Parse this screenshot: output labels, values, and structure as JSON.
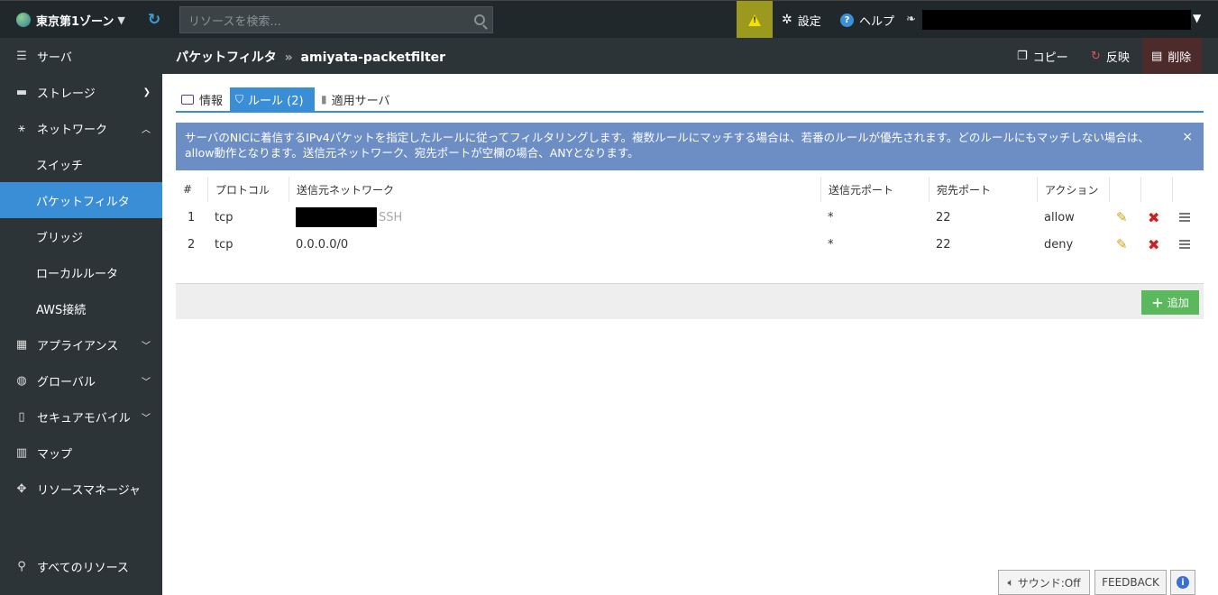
{
  "topbar": {
    "zone": "東京第1ゾーン",
    "zone_caret": "▼",
    "search_placeholder": "リソースを検索...",
    "settings": "設定",
    "help": "ヘルプ",
    "user_caret": "▼"
  },
  "sidebar": {
    "items": [
      {
        "label": "サーバ",
        "icon": "server-icon"
      },
      {
        "label": "ストレージ",
        "icon": "storage-icon"
      },
      {
        "label": "ネットワーク",
        "icon": "network-icon"
      },
      {
        "label": "アプライアンス",
        "icon": "appliance-icon"
      },
      {
        "label": "グローバル",
        "icon": "globe-icon"
      },
      {
        "label": "セキュアモバイル",
        "icon": "mobile-icon"
      },
      {
        "label": "マップ",
        "icon": "map-icon"
      },
      {
        "label": "リソースマネージャ",
        "icon": "puzzle-icon"
      }
    ],
    "network_sub": [
      "スイッチ",
      "パケットフィルタ",
      "ブリッジ",
      "ローカルルータ",
      "AWS接続"
    ],
    "all_resources": "すべてのリソース"
  },
  "header": {
    "breadcrumb_parent": "パケットフィルタ",
    "breadcrumb_sep": "»",
    "breadcrumb_current": "amiyata-packetfilter",
    "copy": "コピー",
    "apply": "反映",
    "delete": "削除"
  },
  "tabs": [
    "情報",
    "ルール (2)",
    "適用サーバ"
  ],
  "notice": "サーバのNICに着信するIPv4パケットを指定したルールに従ってフィルタリングします。複数ルールにマッチする場合は、若番のルールが優先されます。どのルールにもマッチしない場合は、allow動作となります。送信元ネットワーク、宛先ポートが空欄の場合、ANYとなります。",
  "table": {
    "headers": [
      "#",
      "プロトコル",
      "送信元ネットワーク",
      "送信元ポート",
      "宛先ポート",
      "アクション"
    ],
    "rows": [
      {
        "num": "1",
        "protocol": "tcp",
        "source_network": "",
        "source_note": "SSH",
        "source_port": "*",
        "dest_port": "22",
        "action": "allow"
      },
      {
        "num": "2",
        "protocol": "tcp",
        "source_network": "0.0.0.0/0",
        "source_note": "",
        "source_port": "*",
        "dest_port": "22",
        "action": "deny"
      }
    ]
  },
  "add_button": "追加",
  "footer": {
    "sound": "サウンド:Off",
    "feedback": "FEEDBACK",
    "info": "i"
  },
  "colors": {
    "accent": "#3a8ed6",
    "sidebar": "#2d3437",
    "notice": "#6c8ec4",
    "add": "#5cb85c"
  }
}
